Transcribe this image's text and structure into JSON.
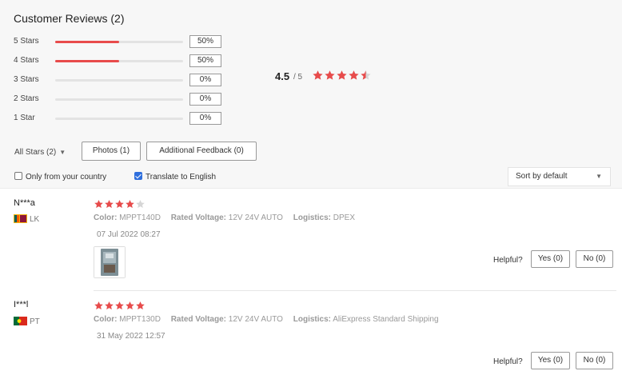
{
  "summary": {
    "title": "Customer Reviews (2)",
    "distribution": [
      {
        "label": "5 Stars",
        "percent": "50%",
        "fraction": 0.5
      },
      {
        "label": "4 Stars",
        "percent": "50%",
        "fraction": 0.5
      },
      {
        "label": "3 Stars",
        "percent": "0%",
        "fraction": 0
      },
      {
        "label": "2 Stars",
        "percent": "0%",
        "fraction": 0
      },
      {
        "label": "1 Star",
        "percent": "0%",
        "fraction": 0
      }
    ],
    "average": "4.5",
    "average_of": "/ 5",
    "average_rating": 4.5
  },
  "filters": {
    "all_stars": "All Stars (2)",
    "photos": "Photos (1)",
    "additional_feedback": "Additional Feedback (0)",
    "only_country": "Only from your country",
    "only_country_checked": false,
    "translate": "Translate to English",
    "translate_checked": true,
    "sort": "Sort by default"
  },
  "reviews": [
    {
      "name": "N***a",
      "country": "LK",
      "rating": 4,
      "color_label": "Color:",
      "color": "MPPT140D",
      "voltage_label": "Rated Voltage:",
      "voltage": "12V 24V AUTO",
      "logistics_label": "Logistics:",
      "logistics": "DPEX",
      "date": "07 Jul 2022 08:27",
      "has_photo": true,
      "helpful_label": "Helpful?",
      "yes": "Yes (0)",
      "no": "No (0)"
    },
    {
      "name": "I***l",
      "country": "PT",
      "rating": 5,
      "color_label": "Color:",
      "color": "MPPT130D",
      "voltage_label": "Rated Voltage:",
      "voltage": "12V 24V AUTO",
      "logistics_label": "Logistics:",
      "logistics": "AliExpress Standard Shipping",
      "date": "31 May 2022 12:57",
      "has_photo": false,
      "helpful_label": "Helpful?",
      "yes": "Yes (0)",
      "no": "No (0)"
    }
  ],
  "colors": {
    "star_filled": "#e84b4b",
    "star_empty": "#d6d6d6",
    "bar_fill": "#e84b4b",
    "checkbox_checked": "#2f6fdd"
  },
  "icons": {
    "dropdown": "chevron-down-icon",
    "star": "star-icon",
    "flag_lk": "sri-lanka-flag-icon",
    "flag_pt": "portugal-flag-icon"
  }
}
